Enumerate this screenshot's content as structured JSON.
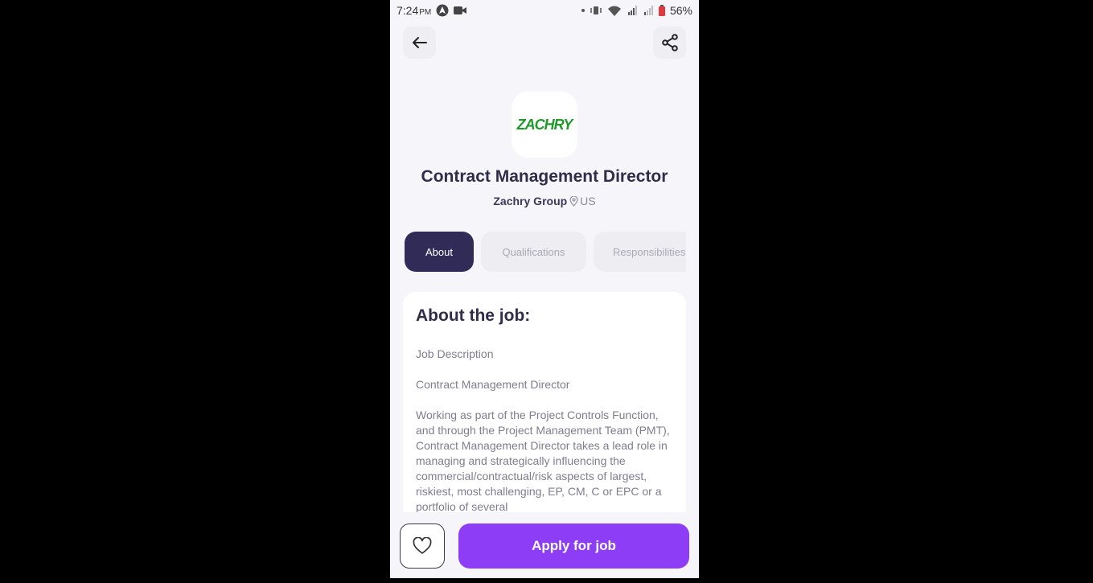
{
  "status_bar": {
    "time": "7:24",
    "ampm": "PM",
    "battery": "56%"
  },
  "header": {
    "back_icon": "arrow-left-icon",
    "share_icon": "share-icon"
  },
  "company": {
    "logo_text": "ZACHRY",
    "name": "Zachry Group",
    "location": "US"
  },
  "job": {
    "title": "Contract Management Director"
  },
  "tabs": [
    {
      "label": "About",
      "active": true
    },
    {
      "label": "Qualifications",
      "active": false
    },
    {
      "label": "Responsibilities",
      "active": false
    }
  ],
  "about": {
    "heading": "About the job:",
    "paragraphs": [
      "Job Description",
      "Contract Management Director",
      "Working as part of the Project Controls Function, and through the Project Management Team (PMT), Contract Management Director takes a lead role in managing and strategically influencing the commercial/contractual/risk aspects of largest, riskiest, most challenging, EP, CM, C or EPC or a portfolio of several"
    ]
  },
  "actions": {
    "favorite_icon": "heart-icon",
    "apply_label": "Apply for job"
  },
  "colors": {
    "accent": "#8c3df5",
    "tab_active": "#312c57",
    "logo_green": "#1f9a2a"
  }
}
